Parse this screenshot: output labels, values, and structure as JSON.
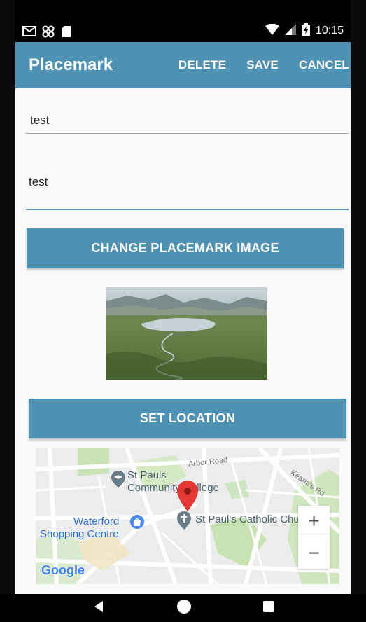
{
  "status_bar": {
    "time": "10:15",
    "icons": [
      "gmail-icon",
      "pinwheel-icon",
      "sdcard-icon",
      "wifi-icon",
      "signal-icon",
      "battery-icon"
    ]
  },
  "app_bar": {
    "title": "Placemark",
    "actions": {
      "delete_label": "DELETE",
      "save_label": "SAVE",
      "cancel_label": "CANCEL"
    }
  },
  "form": {
    "title_value": "test",
    "description_value": "test",
    "change_image_label": "CHANGE PLACEMARK IMAGE",
    "set_location_label": "SET LOCATION"
  },
  "map": {
    "labels": {
      "arbor_road": "Arbor Road",
      "keanes_rd": "Keane's Rd",
      "st_pauls_college_line1": "St Pauls",
      "st_pauls_college_line2": "Community College",
      "st_pauls_church": "St Paul's Catholic Church",
      "waterford_line1": "Waterford",
      "waterford_line2": "Shopping Centre",
      "google_logo": "Google"
    },
    "zoom_in_label": "+",
    "zoom_out_label": "−"
  },
  "colors": {
    "accent": "#4f91b3",
    "marker": "#e53935"
  }
}
